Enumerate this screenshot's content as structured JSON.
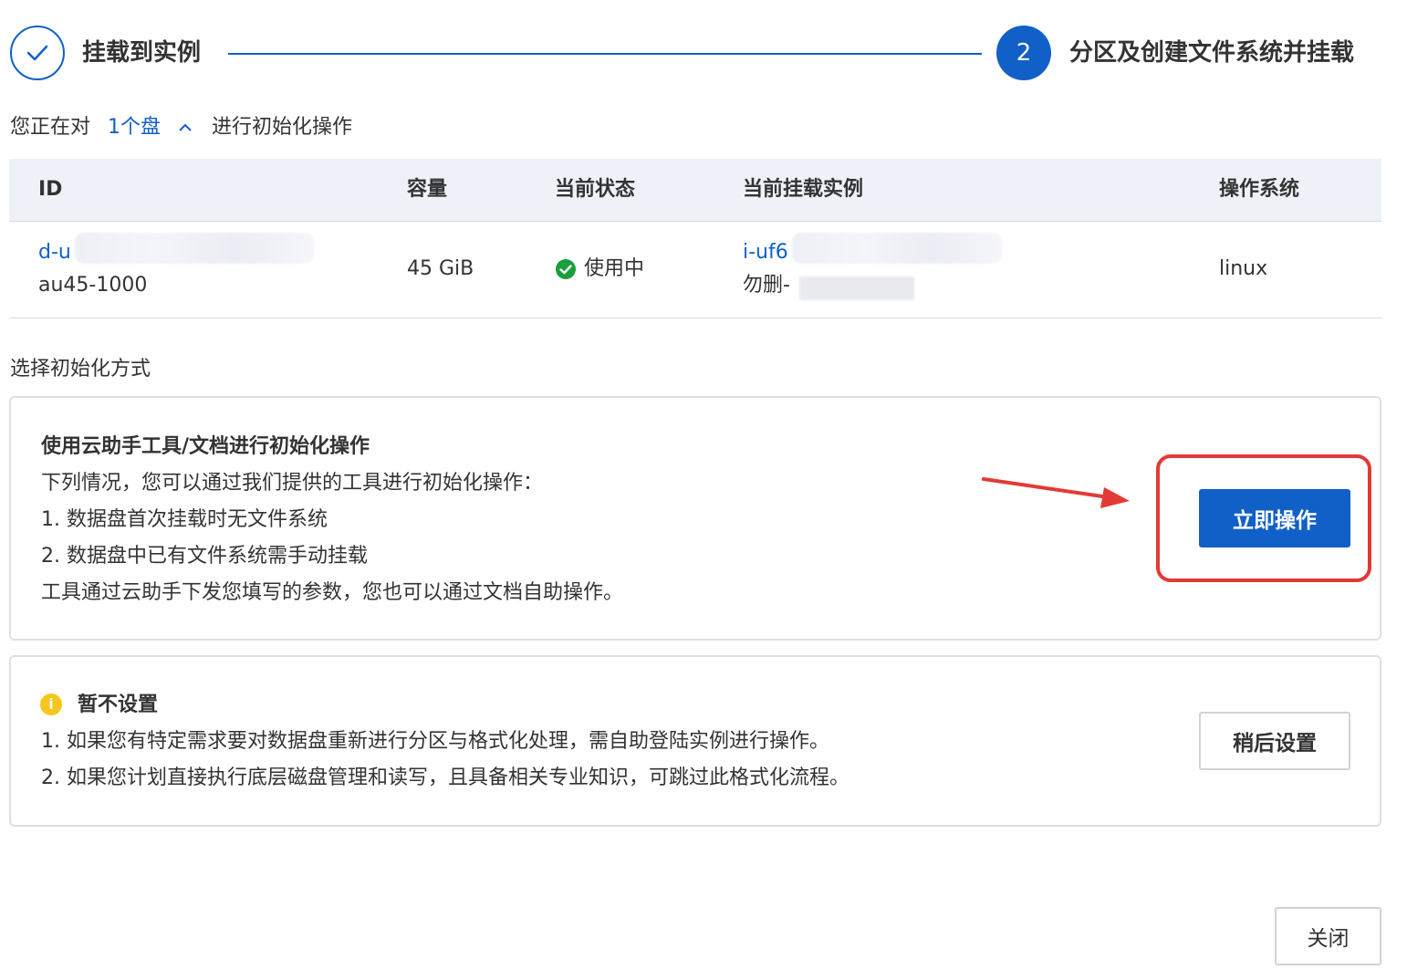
{
  "stepper": {
    "step1": {
      "title": "挂载到实例",
      "status": "completed"
    },
    "step2": {
      "number": "2",
      "title": "分区及创建文件系统并挂载",
      "status": "active"
    }
  },
  "summary": {
    "prefix": "您正在对",
    "disk_count_link": "1个盘",
    "suffix": "进行初始化操作"
  },
  "table": {
    "headers": [
      "ID",
      "容量",
      "当前状态",
      "当前挂载实例",
      "操作系统"
    ],
    "rows": [
      {
        "id_link": "d-u",
        "id_sub": "au45-1000",
        "capacity": "45 GiB",
        "status": "使用中",
        "instance_link": "i-uf6",
        "instance_sub": "勿删-",
        "os": "linux"
      }
    ]
  },
  "section_label": "选择初始化方式",
  "option_tool": {
    "title": "使用云助手工具/文档进行初始化操作",
    "lines": [
      "下列情况，您可以通过我们提供的工具进行初始化操作：",
      "1. 数据盘首次挂载时无文件系统",
      "2. 数据盘中已有文件系统需手动挂载",
      "工具通过云助手下发您填写的参数，您也可以通过文档自助操作。"
    ],
    "button": "立即操作"
  },
  "option_skip": {
    "icon": "info-icon",
    "title": "暂不设置",
    "lines": [
      "1. 如果您有特定需求要对数据盘重新进行分区与格式化处理，需自助登陆实例进行操作。",
      "2. 如果您计划直接执行底层磁盘管理和读写，且具备相关专业知识，可跳过此格式化流程。"
    ],
    "button": "稍后设置"
  },
  "footer": {
    "close_button": "关闭"
  },
  "colors": {
    "primary": "#1160c7",
    "annotation": "#e23a36",
    "success": "#1a9f3c",
    "warning": "#f7c61b"
  }
}
